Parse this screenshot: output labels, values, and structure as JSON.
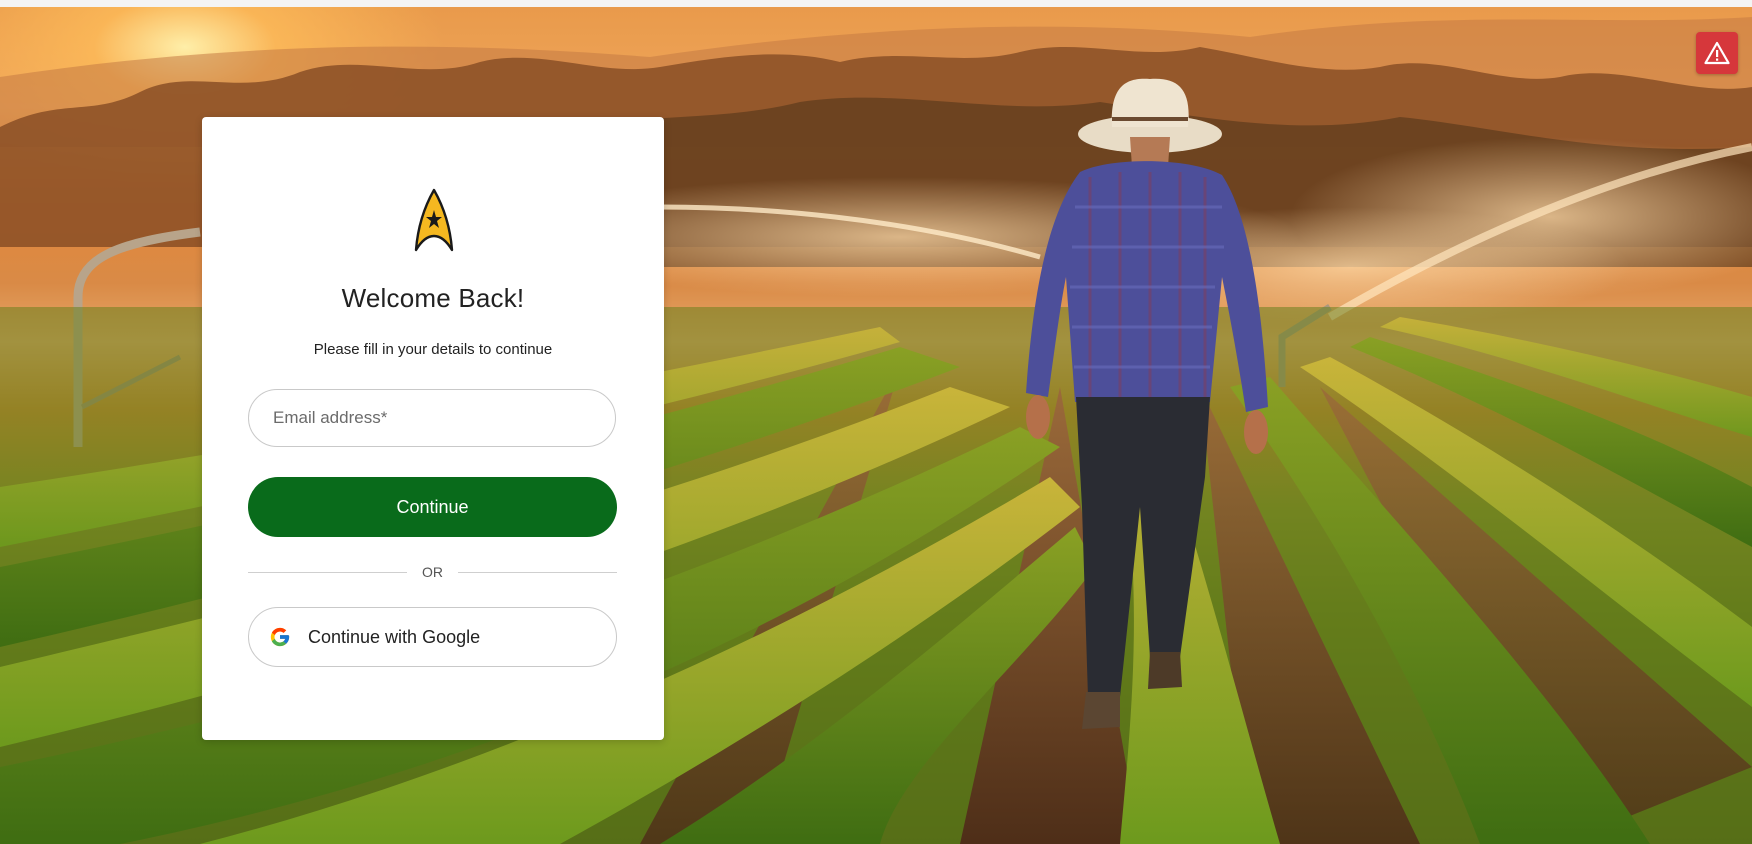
{
  "login": {
    "logo_icon": "starfleet-delta-icon",
    "title": "Welcome Back!",
    "subtitle": "Please fill in your details to continue",
    "email": {
      "placeholder": "Email address*",
      "value": ""
    },
    "continue_label": "Continue",
    "divider_label": "OR",
    "google_label": "Continue with Google",
    "google_icon": "google-icon"
  },
  "alert": {
    "icon": "warning-triangle-icon"
  },
  "colors": {
    "primary_button": "#096b1b",
    "alert_badge": "#d6373b",
    "logo_fill": "#f5b820"
  }
}
